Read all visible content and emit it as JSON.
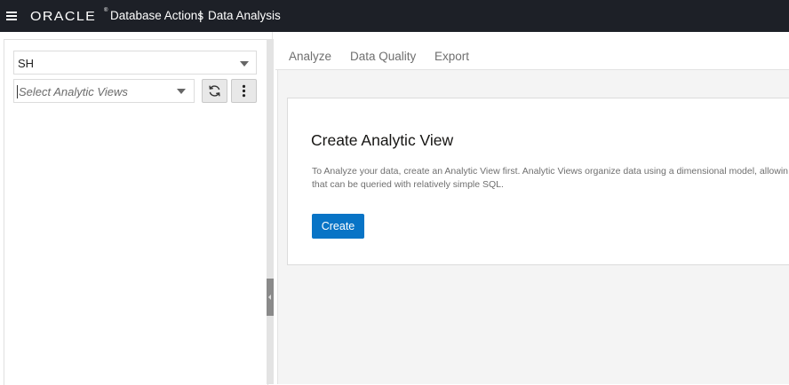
{
  "header": {
    "brand": "ORACLE",
    "brand_mark": "®",
    "app_title": "Database Actions",
    "separator": "|",
    "page_title": "Data Analysis",
    "background": "#1d2027"
  },
  "left_panel": {
    "schema_select": {
      "value": "SH"
    },
    "analytic_view_select": {
      "placeholder": "Select Analytic Views"
    },
    "refresh_icon": "refresh-icon",
    "more_icon": "more-vertical-icon"
  },
  "tabs": [
    {
      "label": "Analyze"
    },
    {
      "label": "Data Quality"
    },
    {
      "label": "Export"
    }
  ],
  "card": {
    "title": "Create Analytic View",
    "description_line1": "To Analyze your data, create an Analytic View first. Analytic Views organize data using a dimensional model, allowin",
    "description_line2": "that can be queried with relatively simple SQL.",
    "create_button": "Create",
    "button_color": "#0874c6"
  }
}
